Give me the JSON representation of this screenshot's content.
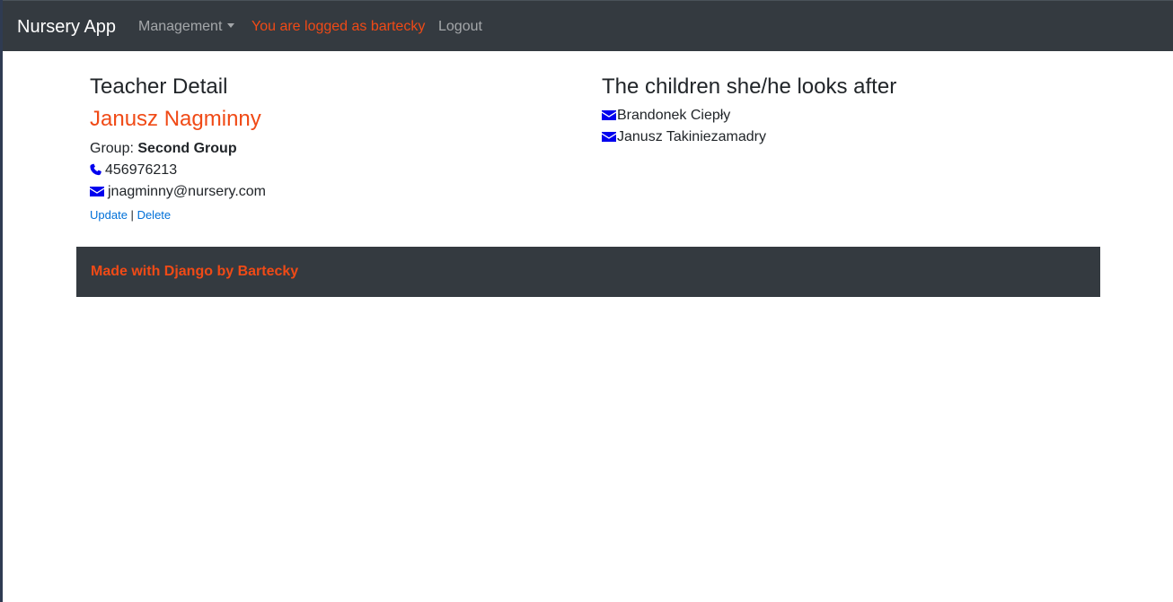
{
  "navbar": {
    "brand": "Nursery App",
    "management_label": "Management",
    "logged_as": "You are logged as bartecky",
    "logout_label": "Logout"
  },
  "teacher": {
    "heading": "Teacher Detail",
    "name": "Janusz Nagminny",
    "group_label": "Group:",
    "group_value": "Second Group",
    "phone": "456976213",
    "email": "jnagminny@nursery.com",
    "update_label": "Update",
    "separator": "|",
    "delete_label": "Delete"
  },
  "children": {
    "heading": "The children she/he looks after",
    "items": [
      {
        "name": "Brandonek Ciepły"
      },
      {
        "name": "Janusz Takiniezamadry"
      }
    ]
  },
  "footer": {
    "text": "Made with Django by Bartecky"
  },
  "colors": {
    "navbar_bg": "#343a40",
    "accent": "#f04a16",
    "link": "#0070d8",
    "icon": "#0000ee"
  },
  "icons": {
    "phone": "phone-icon",
    "email": "envelope-icon"
  }
}
